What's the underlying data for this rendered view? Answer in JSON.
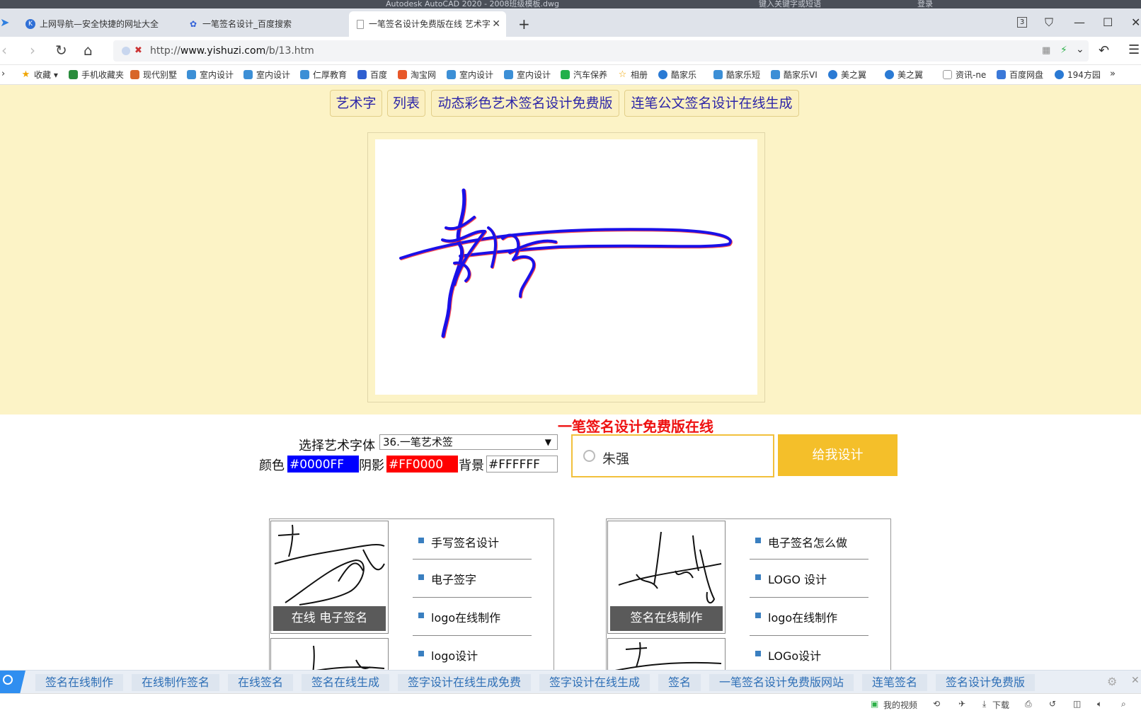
{
  "os_title": "Autodesk AutoCAD 2020 - 2008班级模板.dwg",
  "os_search": "键入关键字或短语",
  "os_login": "登录",
  "tabs": [
    {
      "label": "上网导航—安全快捷的网址大全",
      "active": false,
      "icon": "k-icon"
    },
    {
      "label": "一笔签名设计_百度搜索",
      "active": false,
      "icon": "baidu-paw-icon"
    },
    {
      "label": "一笔签名设计免费版在线 艺术字",
      "active": true,
      "icon": "page-icon"
    }
  ],
  "tab_count": "3",
  "url": {
    "prefix": "http://",
    "host": "www.yishuzi.com",
    "path": "/b/13.htm"
  },
  "bookmarks": [
    "收藏",
    "手机收藏夹",
    "现代别墅",
    "室内设计",
    "室内设计",
    "仁厚教育",
    "百度",
    "淘宝网",
    "室内设计",
    "室内设计",
    "汽车保养",
    "相册",
    "酷家乐",
    "酷家乐短",
    "酷家乐VI",
    "美之翼",
    "美之翼",
    "资讯-ne",
    "百度网盘",
    "194方园"
  ],
  "bookmarks_more": "»",
  "nav_links": [
    "艺术字",
    "列表",
    "动态彩色艺术签名设计免费版",
    "连笔公文签名设计在线生成"
  ],
  "page_title": "一笔签名设计免费版在线",
  "form": {
    "font_label": "选择艺术字体",
    "font_value": "36.一笔艺术签",
    "color_label": "颜色",
    "color_value": "#0000FF",
    "shadow_label": "阴影",
    "shadow_value": "#FF0000",
    "bg_label": "背景",
    "bg_value": "#FFFFFF",
    "name_value": "朱强",
    "submit": "给我设计"
  },
  "colors": {
    "text": "#0000FF",
    "shadow": "#FF0000",
    "background": "#FFFFFF",
    "accent": "#F4BF2A",
    "title": "#EE1111"
  },
  "cards": [
    {
      "caption": "在线 电子签名",
      "links": [
        "手写签名设计",
        "电子签字",
        "logo在线制作",
        "logo设计"
      ]
    },
    {
      "caption": "签名在线制作",
      "links": [
        "电子签名怎么做",
        "LOGO 设计",
        "logo在线制作",
        "LOGo设计"
      ]
    }
  ],
  "bottom_keywords": [
    "签名在线制作",
    "在线制作签名",
    "在线签名",
    "签名在线生成",
    "签字设计在线生成免费",
    "签字设计在线生成",
    "签名",
    "一笔签名设计免费版网站",
    "连笔签名",
    "签名设计免费版"
  ],
  "status": {
    "video": "我的视频",
    "download": "下载"
  }
}
